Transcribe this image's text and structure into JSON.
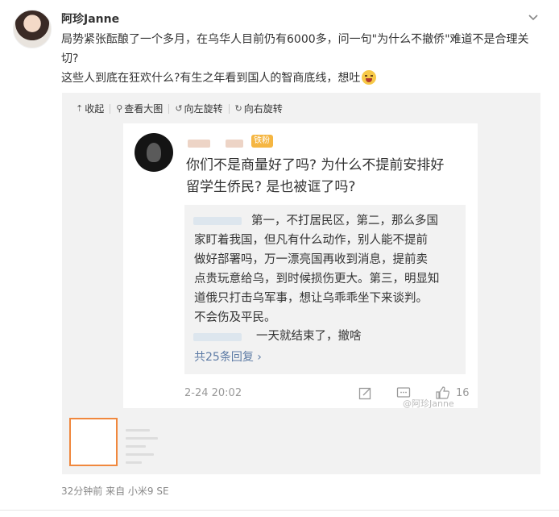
{
  "post": {
    "username": "阿珍Janne",
    "line1": "局势紧张酝酿了一个多月，在乌华人目前仍有6000多，问一句\"为什么不撤侨\"难道不是合理关",
    "line2": "切?",
    "line3": "这些人到底在狂欢什么?有生之年看到国人的智商底线，想吐"
  },
  "toolbar": {
    "collapse": "收起",
    "view_large": "查看大图",
    "rotate_left": "向左旋转",
    "rotate_right": "向右旋转"
  },
  "screenshot": {
    "badge": "铁粉",
    "question_line1": "你们不是商量好了吗? 为什么不提前安排好",
    "question_line2": "留学生侨民? 是也被诓了吗?",
    "reply_lines": [
      "第一，不打居民区，第二，那么多国",
      "家盯着我国，但凡有什么动作，别人能不提前",
      "做好部署吗，万一漂亮国再收到消息，提前卖",
      "点贵玩意给乌，到时候损伤更大。第三，明显知",
      "道俄只打击乌军事，想让乌乖乖坐下来谈判。",
      "不会伤及平民。"
    ],
    "reply2": "一天就结束了，撤啥",
    "reply_count": "共25条回复 ›",
    "time": "2-24 20:02",
    "likes": "16",
    "watermark": "@阿珍Janne"
  },
  "footer": {
    "meta": "32分钟前  来自 小米9 SE"
  },
  "icons": [
    "chevron-down-icon",
    "collapse-icon",
    "zoom-icon",
    "rotate-left-icon",
    "rotate-right-icon",
    "share-icon",
    "comment-icon",
    "like-icon",
    "vomit-emoji-icon"
  ],
  "colors": {
    "link": "#5d7ba5",
    "badge": "#f5b642",
    "thumb_border": "#f0883e"
  }
}
